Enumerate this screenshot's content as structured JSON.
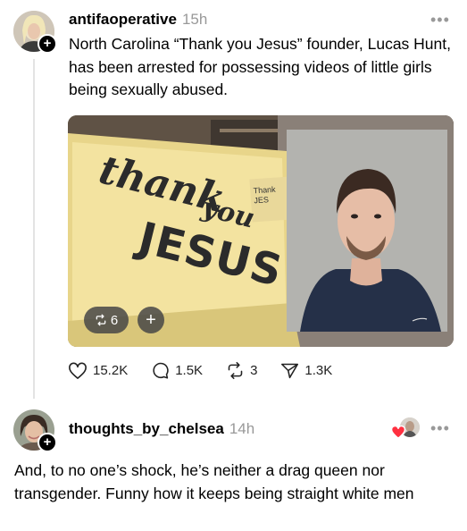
{
  "post": {
    "username": "antifaoperative",
    "timestamp": "15h",
    "more_label": "•••",
    "text": "North Carolina “Thank you Jesus” founder, Lucas Hunt, has been arrested for possessing videos of little girls being sexually abused.",
    "image": {
      "sign_word1": "thank",
      "sign_word2": "you",
      "sign_word3": "JESUS",
      "small_sign_text": "Thank JES",
      "repost_count": "6",
      "plus_label": "+"
    },
    "actions": {
      "likes": "15.2K",
      "comments": "1.5K",
      "reposts": "3",
      "shares": "1.3K"
    }
  },
  "reply": {
    "username": "thoughts_by_chelsea",
    "timestamp": "14h",
    "more_label": "•••",
    "text": "And, to no one’s shock, he’s neither a drag queen nor transgender. Funny how it keeps being straight white men"
  },
  "colors": {
    "like_heart": "#ff3040",
    "muted": "#999999",
    "thread_line": "#e3e3e3"
  }
}
